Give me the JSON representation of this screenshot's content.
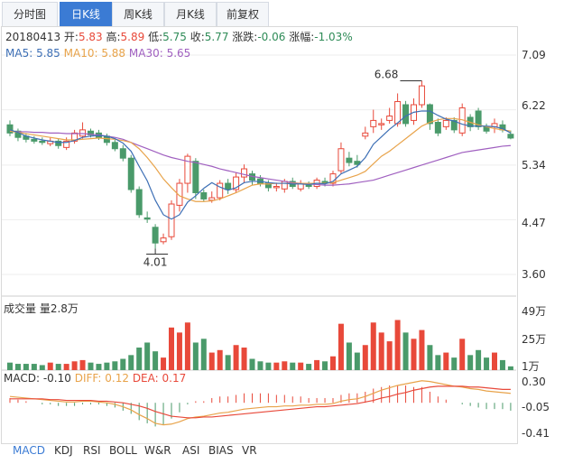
{
  "tabs": [
    "分时图",
    "日K线",
    "周K线",
    "月K线",
    "前复权"
  ],
  "active_tab": 1,
  "info": {
    "date": "20180413",
    "open_label": "开:",
    "open": "5.83",
    "high_label": "高:",
    "high": "5.89",
    "low_label": "低:",
    "low": "5.75",
    "close_label": "收:",
    "close": "5.77",
    "change_label": "涨跌:",
    "change": "-0.06",
    "pct_label": "涨幅:",
    "pct": "-1.03%"
  },
  "ma": {
    "ma5_label": "MA5:",
    "ma5": "5.85",
    "ma10_label": "MA10:",
    "ma10": "5.88",
    "ma30_label": "MA30:",
    "ma30": "5.65"
  },
  "volume_label": "成交量 量2.8万",
  "macd": {
    "label": "MACD:",
    "macd": "-0.10",
    "diff_label": "DIFF:",
    "diff": "0.12",
    "dea_label": "DEA:",
    "dea": "0.17"
  },
  "price_axis": [
    "7.09",
    "6.22",
    "5.34",
    "4.47",
    "3.60"
  ],
  "volume_axis": [
    "49万",
    "25万",
    "1万"
  ],
  "macd_axis": [
    "0.30",
    "-0.05",
    "-0.41"
  ],
  "annotations": {
    "max": "6.68",
    "min": "4.01"
  },
  "bottom_tabs": [
    "MACD",
    "KDJ",
    "RSI",
    "BOLL",
    "W&R",
    "ASI",
    "BIAS",
    "VR"
  ],
  "active_bottom_tab": 0,
  "colors": {
    "up": "#e8493a",
    "down": "#4a9a6a",
    "ma5": "#3d6fb5",
    "ma10": "#e8a34a",
    "ma30": "#a060c0",
    "accent": "#3b7bd4"
  },
  "chart_data": {
    "type": "candlestick",
    "ylim": [
      3.6,
      7.09
    ],
    "candles": [
      [
        5.98,
        5.85,
        6.05,
        5.8
      ],
      [
        5.88,
        5.78,
        5.92,
        5.72
      ],
      [
        5.8,
        5.75,
        5.85,
        5.7
      ],
      [
        5.75,
        5.72,
        5.8,
        5.68
      ],
      [
        5.72,
        5.7,
        5.78,
        5.66
      ],
      [
        5.68,
        5.72,
        5.78,
        5.64
      ],
      [
        5.72,
        5.65,
        5.76,
        5.6
      ],
      [
        5.62,
        5.72,
        5.78,
        5.58
      ],
      [
        5.72,
        5.85,
        5.9,
        5.68
      ],
      [
        5.8,
        5.9,
        6.02,
        5.76
      ],
      [
        5.88,
        5.82,
        5.92,
        5.78
      ],
      [
        5.85,
        5.78,
        5.9,
        5.74
      ],
      [
        5.8,
        5.7,
        5.84,
        5.65
      ],
      [
        5.7,
        5.6,
        5.74,
        5.56
      ],
      [
        5.6,
        5.45,
        5.66,
        5.4
      ],
      [
        5.45,
        4.95,
        5.5,
        4.9
      ],
      [
        4.95,
        4.55,
        5.0,
        4.5
      ],
      [
        4.5,
        4.48,
        4.6,
        4.42
      ],
      [
        4.35,
        4.1,
        4.4,
        4.01
      ],
      [
        4.12,
        4.18,
        4.25,
        4.08
      ],
      [
        4.2,
        4.72,
        4.78,
        4.15
      ],
      [
        4.7,
        5.05,
        5.12,
        4.6
      ],
      [
        5.05,
        5.48,
        5.52,
        4.9
      ],
      [
        5.4,
        4.9,
        5.45,
        4.8
      ],
      [
        4.9,
        4.8,
        4.95,
        4.76
      ],
      [
        4.78,
        4.82,
        4.92,
        4.74
      ],
      [
        4.82,
        5.05,
        5.1,
        4.78
      ],
      [
        5.05,
        4.95,
        5.12,
        4.88
      ],
      [
        4.95,
        5.15,
        5.22,
        4.9
      ],
      [
        5.15,
        5.28,
        5.35,
        5.05
      ],
      [
        5.2,
        5.1,
        5.25,
        5.02
      ],
      [
        5.12,
        5.05,
        5.18,
        5.0
      ],
      [
        5.05,
        4.98,
        5.1,
        4.92
      ],
      [
        4.98,
        5.0,
        5.06,
        4.92
      ],
      [
        4.96,
        5.08,
        5.12,
        4.9
      ],
      [
        5.08,
        5.0,
        5.14,
        4.96
      ],
      [
        4.96,
        5.05,
        5.1,
        4.92
      ],
      [
        5.02,
        5.0,
        5.08,
        4.96
      ],
      [
        5.0,
        5.1,
        5.14,
        4.96
      ],
      [
        5.08,
        5.05,
        5.14,
        5.0
      ],
      [
        5.05,
        5.2,
        5.25,
        5.0
      ],
      [
        5.25,
        5.6,
        5.7,
        5.2
      ],
      [
        5.45,
        5.38,
        5.55,
        5.32
      ],
      [
        5.4,
        5.35,
        5.5,
        5.3
      ],
      [
        5.8,
        5.85,
        5.95,
        5.75
      ],
      [
        5.95,
        6.05,
        6.22,
        5.85
      ],
      [
        5.98,
        6.0,
        6.08,
        5.9
      ],
      [
        6.05,
        6.12,
        6.25,
        6.0
      ],
      [
        6.0,
        6.35,
        6.48,
        5.95
      ],
      [
        6.3,
        6.0,
        6.36,
        5.95
      ],
      [
        6.05,
        6.3,
        6.4,
        5.98
      ],
      [
        6.3,
        6.6,
        6.68,
        6.25
      ],
      [
        6.3,
        6.0,
        6.32,
        5.9
      ],
      [
        6.02,
        5.85,
        6.08,
        5.8
      ],
      [
        5.95,
        6.05,
        6.1,
        5.9
      ],
      [
        6.05,
        5.9,
        6.1,
        5.85
      ],
      [
        5.85,
        6.25,
        6.32,
        5.8
      ],
      [
        6.1,
        5.95,
        6.15,
        5.88
      ],
      [
        6.2,
        5.95,
        6.25,
        5.9
      ],
      [
        5.95,
        5.88,
        6.0,
        5.84
      ],
      [
        5.95,
        6.0,
        6.08,
        5.85
      ],
      [
        5.98,
        5.9,
        6.05,
        5.86
      ],
      [
        5.83,
        5.77,
        5.89,
        5.75
      ]
    ],
    "ma5": [
      5.9,
      5.86,
      5.8,
      5.77,
      5.74,
      5.72,
      5.7,
      5.7,
      5.73,
      5.78,
      5.8,
      5.81,
      5.8,
      5.76,
      5.69,
      5.56,
      5.32,
      5.09,
      4.78,
      4.55,
      4.48,
      4.55,
      4.75,
      4.85,
      4.97,
      5.06,
      4.99,
      4.94,
      4.98,
      5.06,
      5.08,
      5.08,
      5.06,
      5.05,
      5.05,
      5.04,
      5.04,
      5.03,
      5.05,
      5.04,
      5.08,
      5.2,
      5.26,
      5.32,
      5.46,
      5.67,
      5.79,
      5.91,
      6.01,
      6.12,
      6.18,
      6.2,
      6.2,
      6.13,
      6.07,
      6.04,
      5.99,
      5.96,
      5.96,
      5.96,
      5.95,
      5.92,
      5.85
    ],
    "ma10": [
      5.88,
      5.86,
      5.84,
      5.82,
      5.8,
      5.78,
      5.76,
      5.74,
      5.74,
      5.75,
      5.76,
      5.77,
      5.76,
      5.75,
      5.73,
      5.7,
      5.6,
      5.46,
      5.3,
      5.12,
      4.98,
      4.85,
      4.8,
      4.76,
      4.76,
      4.77,
      4.8,
      4.85,
      4.9,
      4.96,
      5.02,
      5.04,
      5.04,
      5.05,
      5.05,
      5.05,
      5.05,
      5.05,
      5.05,
      5.05,
      5.06,
      5.1,
      5.14,
      5.18,
      5.24,
      5.36,
      5.48,
      5.56,
      5.66,
      5.76,
      5.86,
      5.96,
      6.02,
      6.06,
      6.08,
      6.08,
      6.06,
      6.02,
      5.98,
      5.95,
      5.92,
      5.9,
      5.88
    ],
    "ma30": [
      5.88,
      5.87,
      5.87,
      5.86,
      5.86,
      5.85,
      5.85,
      5.84,
      5.84,
      5.84,
      5.83,
      5.82,
      5.8,
      5.78,
      5.75,
      5.7,
      5.65,
      5.6,
      5.55,
      5.5,
      5.46,
      5.43,
      5.4,
      5.38,
      5.35,
      5.32,
      5.28,
      5.25,
      5.22,
      5.19,
      5.16,
      5.14,
      5.12,
      5.1,
      5.08,
      5.06,
      5.05,
      5.04,
      5.03,
      5.02,
      5.02,
      5.03,
      5.04,
      5.06,
      5.08,
      5.1,
      5.14,
      5.18,
      5.22,
      5.26,
      5.3,
      5.34,
      5.38,
      5.42,
      5.46,
      5.5,
      5.54,
      5.56,
      5.58,
      5.6,
      5.62,
      5.64,
      5.65
    ],
    "volume_ylim": [
      0,
      49
    ],
    "volume": [
      6,
      5,
      5,
      5,
      4,
      6,
      5,
      5,
      7,
      8,
      6,
      5,
      6,
      7,
      9,
      12,
      18,
      22,
      15,
      10,
      34,
      30,
      38,
      22,
      25,
      14,
      16,
      12,
      20,
      18,
      9,
      7,
      6,
      6,
      7,
      6,
      6,
      5,
      8,
      7,
      11,
      37,
      22,
      14,
      20,
      38,
      30,
      23,
      40,
      30,
      25,
      32,
      20,
      12,
      14,
      10,
      25,
      12,
      16,
      10,
      14,
      8,
      3
    ],
    "macd_ylim": [
      -0.41,
      0.3
    ],
    "diff": [
      0.08,
      0.07,
      0.06,
      0.05,
      0.04,
      0.03,
      0.02,
      0.01,
      0.01,
      0.02,
      0.02,
      0.01,
      0.0,
      -0.02,
      -0.05,
      -0.09,
      -0.15,
      -0.2,
      -0.26,
      -0.28,
      -0.27,
      -0.24,
      -0.2,
      -0.18,
      -0.17,
      -0.15,
      -0.13,
      -0.12,
      -0.1,
      -0.08,
      -0.07,
      -0.06,
      -0.05,
      -0.05,
      -0.04,
      -0.04,
      -0.03,
      -0.03,
      -0.02,
      -0.02,
      -0.01,
      0.02,
      0.04,
      0.05,
      0.08,
      0.12,
      0.16,
      0.19,
      0.22,
      0.24,
      0.26,
      0.28,
      0.27,
      0.25,
      0.23,
      0.21,
      0.2,
      0.18,
      0.17,
      0.15,
      0.14,
      0.13,
      0.12
    ],
    "dea": [
      0.05,
      0.05,
      0.05,
      0.05,
      0.05,
      0.04,
      0.04,
      0.03,
      0.03,
      0.03,
      0.03,
      0.02,
      0.02,
      0.01,
      0.0,
      -0.02,
      -0.04,
      -0.07,
      -0.11,
      -0.14,
      -0.17,
      -0.18,
      -0.19,
      -0.19,
      -0.18,
      -0.18,
      -0.17,
      -0.16,
      -0.15,
      -0.14,
      -0.13,
      -0.12,
      -0.11,
      -0.1,
      -0.09,
      -0.08,
      -0.07,
      -0.06,
      -0.05,
      -0.05,
      -0.04,
      -0.03,
      -0.02,
      -0.01,
      0.01,
      0.03,
      0.06,
      0.08,
      0.11,
      0.13,
      0.16,
      0.18,
      0.2,
      0.21,
      0.21,
      0.21,
      0.21,
      0.2,
      0.2,
      0.19,
      0.18,
      0.17,
      0.17
    ]
  }
}
